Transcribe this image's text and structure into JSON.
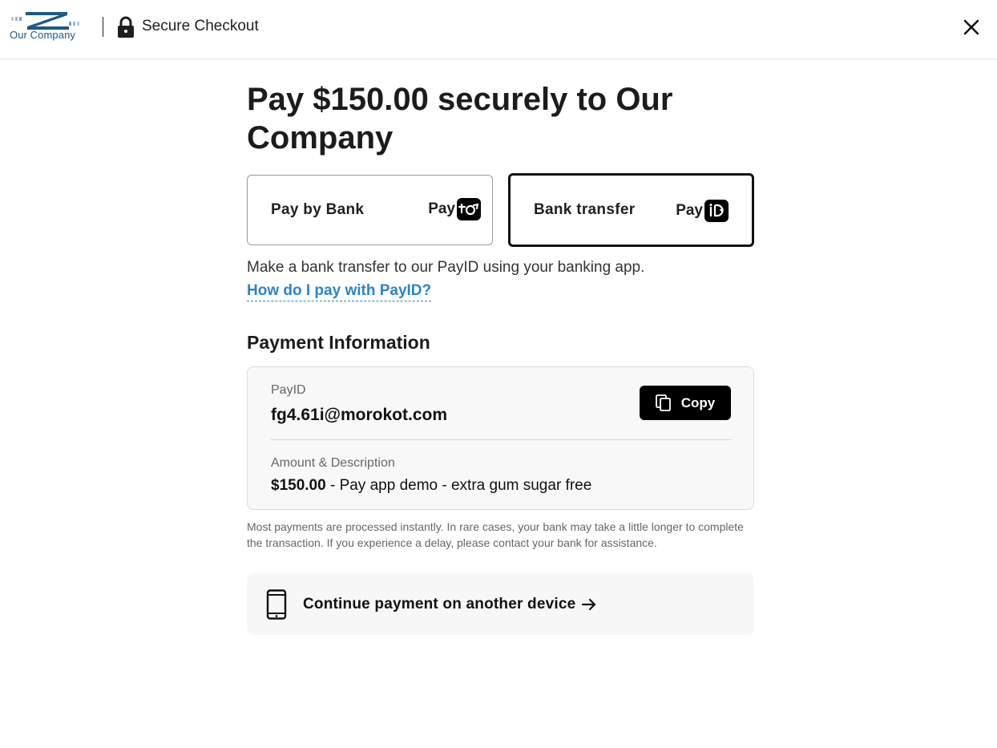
{
  "header": {
    "company_name": "Our Company",
    "title": "Secure Checkout",
    "icons": {
      "lock": "lock-icon",
      "close": "close-icon"
    }
  },
  "main": {
    "title": "Pay $150.00 securely to Our Company",
    "methods": [
      {
        "label": "Pay by Bank",
        "logo_word": "Pay",
        "logo": "payto-logo",
        "selected": false
      },
      {
        "label": "Bank transfer",
        "logo_word": "Pay",
        "logo": "payid-logo",
        "selected": true
      }
    ],
    "description": "Make a bank transfer to our PayID using your banking app.",
    "help_link": "How do I pay with PayID?"
  },
  "payment_info": {
    "section_title": "Payment Information",
    "payid_label": "PayID",
    "payid_value": "fg4.61i@morokot.com",
    "copy_label": "Copy",
    "amount_label": "Amount & Description",
    "amount": "$150.00",
    "description": " - Pay app demo - extra gum sugar free"
  },
  "notice": "Most payments are processed instantly. In rare cases, your bank may take a little longer to complete the transaction. If you experience a delay, please contact your bank for assistance.",
  "continue": {
    "label": "Continue payment on another device",
    "icons": {
      "device": "phone-icon",
      "arrow": "arrow-right-icon"
    }
  },
  "colors": {
    "link": "#2b86c5",
    "brand": "#1d5a86",
    "button_bg": "#000000",
    "card_bg": "#f8f8f8"
  }
}
